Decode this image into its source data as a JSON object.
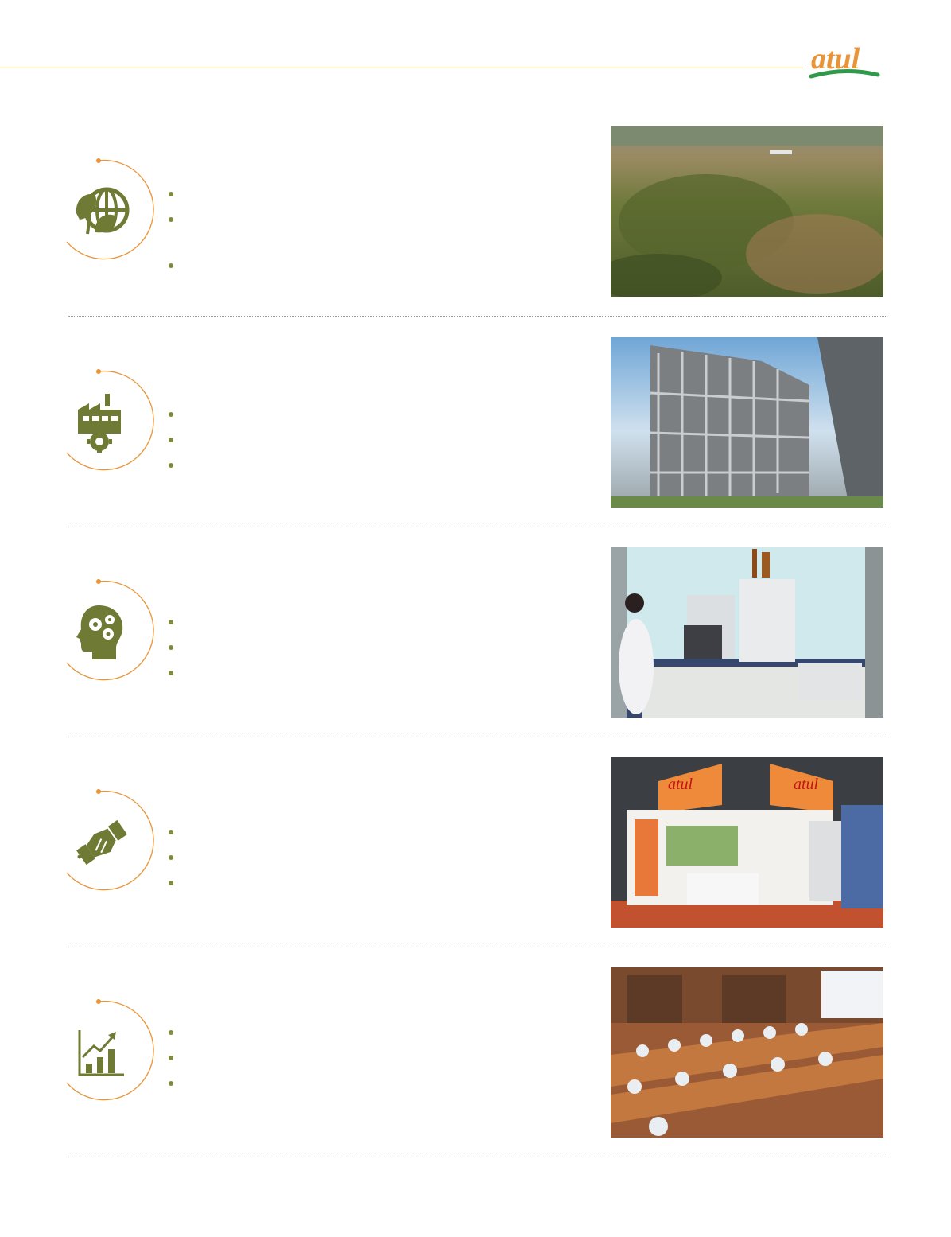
{
  "brand": {
    "logo_text": "atul",
    "accent_color": "#e8953a",
    "icon_color": "#6f7a35"
  },
  "sections": [
    {
      "icon": "globe-leaf-icon",
      "bullet_count": 3,
      "photo": "aerial-plantation-photo"
    },
    {
      "icon": "factory-gear-icon",
      "bullet_count": 3,
      "photo": "chemical-plant-photo"
    },
    {
      "icon": "head-gears-icon",
      "bullet_count": 3,
      "photo": "laboratory-photo"
    },
    {
      "icon": "handshake-icon",
      "bullet_count": 3,
      "photo": "exhibition-stall-photo"
    },
    {
      "icon": "growth-chart-icon",
      "bullet_count": 3,
      "photo": "training-seminar-photo"
    }
  ]
}
